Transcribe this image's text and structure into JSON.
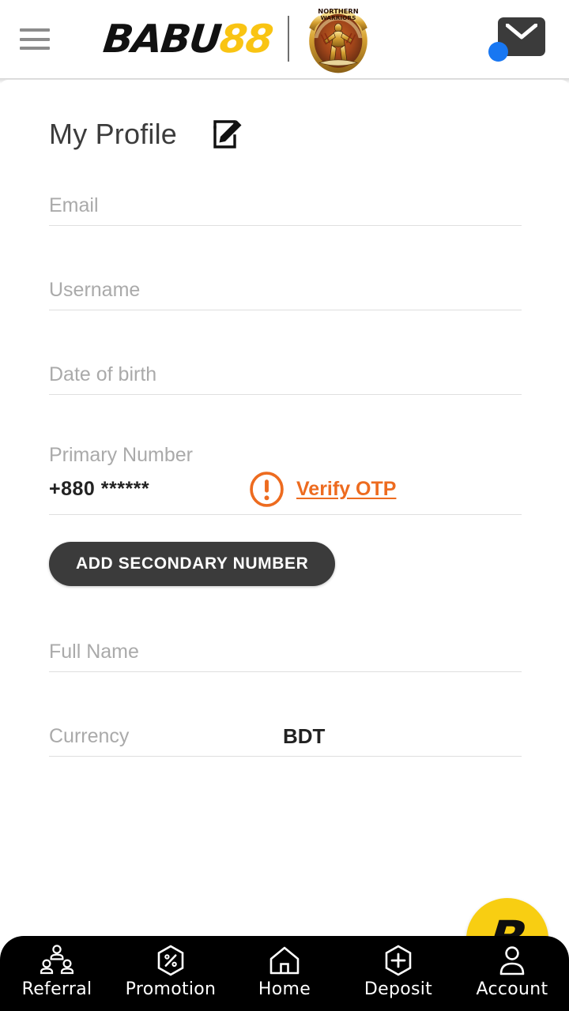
{
  "header": {
    "menu_icon": "hamburger-menu-icon",
    "brand_primary": "BABU",
    "brand_accent": "88",
    "sponsor_emblem_top_text": "NORTHERN WARRIORS",
    "mail_icon": "mail-envelope-icon",
    "mail_badge": "",
    "colors": {
      "brand_black": "#111111",
      "brand_yellow": "#F9C413",
      "badge_blue": "#1877F2",
      "mail_dark": "#3B3B3B"
    }
  },
  "page": {
    "title": "My Profile",
    "edit_icon": "edit-pencil-square-icon"
  },
  "form": {
    "fields": [
      {
        "label": "Email",
        "value": ""
      },
      {
        "label": "Username",
        "value": ""
      },
      {
        "label": "Date of birth",
        "value": ""
      }
    ],
    "primary_number": {
      "label": "Primary Number",
      "value": "+880 ******",
      "warning_icon": "warning-exclamation-circle-icon",
      "verify_link": "Verify OTP",
      "verify_color": "#ED6B1F"
    },
    "add_secondary_button": "ADD SECONDARY NUMBER",
    "full_name": {
      "label": "Full Name",
      "value": ""
    },
    "currency": {
      "label": "Currency",
      "value": "BDT"
    }
  },
  "fab": {
    "icon": "babu-b-logo-icon",
    "letter": "B",
    "color": "#F8CE12"
  },
  "bottom_nav": {
    "items": [
      {
        "label": "Referral",
        "icon": "people-network-icon"
      },
      {
        "label": "Promotion",
        "icon": "percent-hexagon-icon"
      },
      {
        "label": "Home",
        "icon": "home-house-icon"
      },
      {
        "label": "Deposit",
        "icon": "plus-hexagon-icon"
      },
      {
        "label": "Account",
        "icon": "user-person-icon"
      }
    ]
  }
}
